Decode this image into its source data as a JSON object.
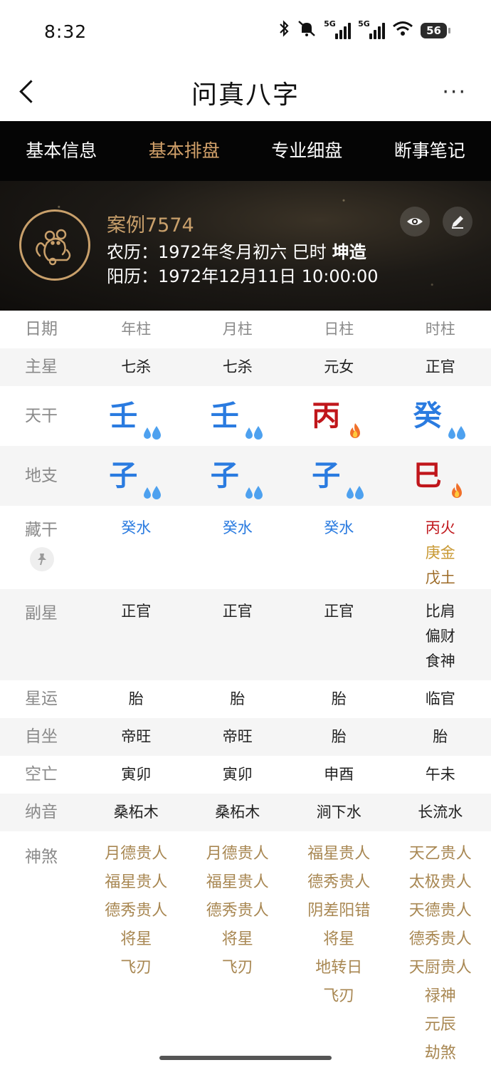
{
  "status_bar": {
    "time": "8:32",
    "signal1": "5G",
    "signal2": "5G",
    "battery": "56"
  },
  "header": {
    "title": "问真八字",
    "more": "···"
  },
  "tabs": [
    {
      "label": "基本信息"
    },
    {
      "label": "基本排盘",
      "active": true
    },
    {
      "label": "专业细盘"
    },
    {
      "label": "断事笔记"
    }
  ],
  "profile": {
    "case_name": "案例7574",
    "lunar": "农历：1972年冬月初六 巳时",
    "gender": "坤造",
    "solar": "阳历：1972年12月11日 10:00:00",
    "zodiac_icon": "rat-icon"
  },
  "table": {
    "header": {
      "label": "日期",
      "cols": [
        "年柱",
        "月柱",
        "日柱",
        "时柱"
      ]
    },
    "zhuxing": {
      "label": "主星",
      "values": [
        "七杀",
        "七杀",
        "元女",
        "正官"
      ]
    },
    "tiangan": {
      "label": "天干",
      "values": [
        {
          "char": "壬",
          "element": "water"
        },
        {
          "char": "壬",
          "element": "water"
        },
        {
          "char": "丙",
          "element": "fire"
        },
        {
          "char": "癸",
          "element": "water"
        }
      ]
    },
    "dizhi": {
      "label": "地支",
      "values": [
        {
          "char": "子",
          "element": "water"
        },
        {
          "char": "子",
          "element": "water"
        },
        {
          "char": "子",
          "element": "water"
        },
        {
          "char": "巳",
          "element": "fire"
        }
      ]
    },
    "canggan": {
      "label": "藏干",
      "values": [
        [
          "癸水"
        ],
        [
          "癸水"
        ],
        [
          "癸水"
        ],
        [
          "丙火",
          "庚金",
          "戊土"
        ]
      ]
    },
    "fuxing": {
      "label": "副星",
      "values": [
        [
          "正官"
        ],
        [
          "正官"
        ],
        [
          "正官"
        ],
        [
          "比肩",
          "偏财",
          "食神"
        ]
      ]
    },
    "xingyun": {
      "label": "星运",
      "values": [
        "胎",
        "胎",
        "胎",
        "临官"
      ]
    },
    "zizuo": {
      "label": "自坐",
      "values": [
        "帝旺",
        "帝旺",
        "胎",
        "胎"
      ]
    },
    "kongwang": {
      "label": "空亡",
      "values": [
        "寅卯",
        "寅卯",
        "申酉",
        "午未"
      ]
    },
    "nayin": {
      "label": "纳音",
      "values": [
        "桑柘木",
        "桑柘木",
        "涧下水",
        "长流水"
      ]
    },
    "shensha": {
      "label": "神煞",
      "values": [
        [
          "月德贵人",
          "福星贵人",
          "德秀贵人",
          "将星",
          "飞刃"
        ],
        [
          "月德贵人",
          "福星贵人",
          "德秀贵人",
          "将星",
          "飞刃"
        ],
        [
          "福星贵人",
          "德秀贵人",
          "阴差阳错",
          "将星",
          "地转日",
          "飞刃"
        ],
        [
          "天乙贵人",
          "太极贵人",
          "天德贵人",
          "德秀贵人",
          "天厨贵人",
          "禄神",
          "元辰",
          "劫煞"
        ]
      ]
    }
  },
  "colors": {
    "water": "#2a7be0",
    "fire": "#c0161b",
    "metal": "#c99a35",
    "earth": "#9c6a26",
    "gold_text": "#a88752",
    "active_tab": "#d2a16a"
  }
}
